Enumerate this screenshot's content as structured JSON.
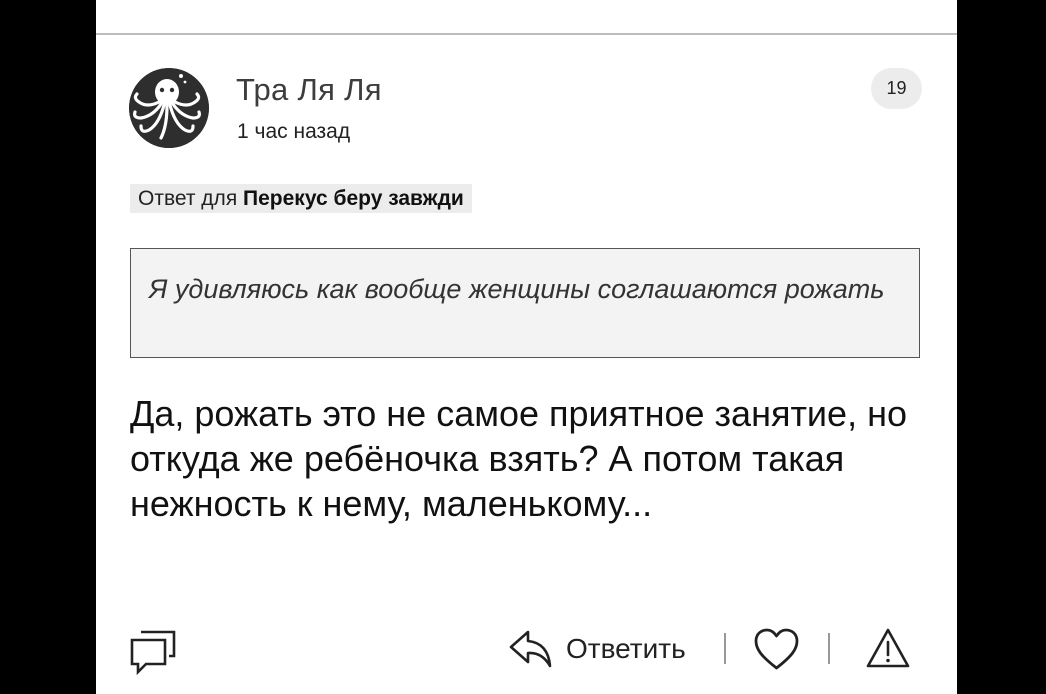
{
  "comment": {
    "author": "Тра Ля Ля",
    "time": "1 час назад",
    "likes": "19",
    "reply_prefix": "Ответ для",
    "reply_to_name": "Перекус беру завжди",
    "quote": "Я удивляюсь как вообще женщины соглашаются рожать",
    "text": "Да, рожать это не самое приятное занятие, но откуда же ребёночка взять? А потом такая нежность к нему, маленькому..."
  },
  "actions": {
    "reply_label": "Ответить"
  },
  "icons": {
    "avatar": "octopus-avatar-icon",
    "comments": "comments-icon",
    "reply": "reply-arrow-icon",
    "like": "heart-icon",
    "report": "warning-triangle-icon"
  },
  "colors": {
    "background": "#000000",
    "card": "#ffffff",
    "badge": "#ececec",
    "quote_bg": "#f3f3f3",
    "text": "#111111"
  }
}
